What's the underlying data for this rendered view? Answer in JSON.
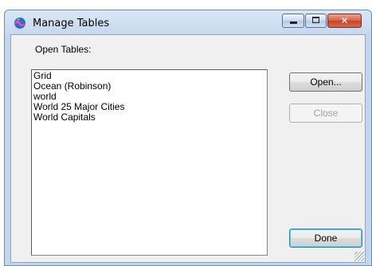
{
  "window": {
    "title": "Manage Tables",
    "controls": {
      "minimize": "minimize",
      "maximize": "maximize",
      "close": "✕"
    }
  },
  "dialog": {
    "list_label": "Open Tables:",
    "tables": [
      "Grid",
      "Ocean (Robinson)",
      "world",
      "World 25 Major Cities",
      "World Capitals"
    ],
    "buttons": {
      "open": "Open...",
      "close": "Close",
      "done": "Done"
    },
    "close_enabled": false
  },
  "colors": {
    "accent": "#c4422a",
    "frame": "#c4d6ec"
  }
}
